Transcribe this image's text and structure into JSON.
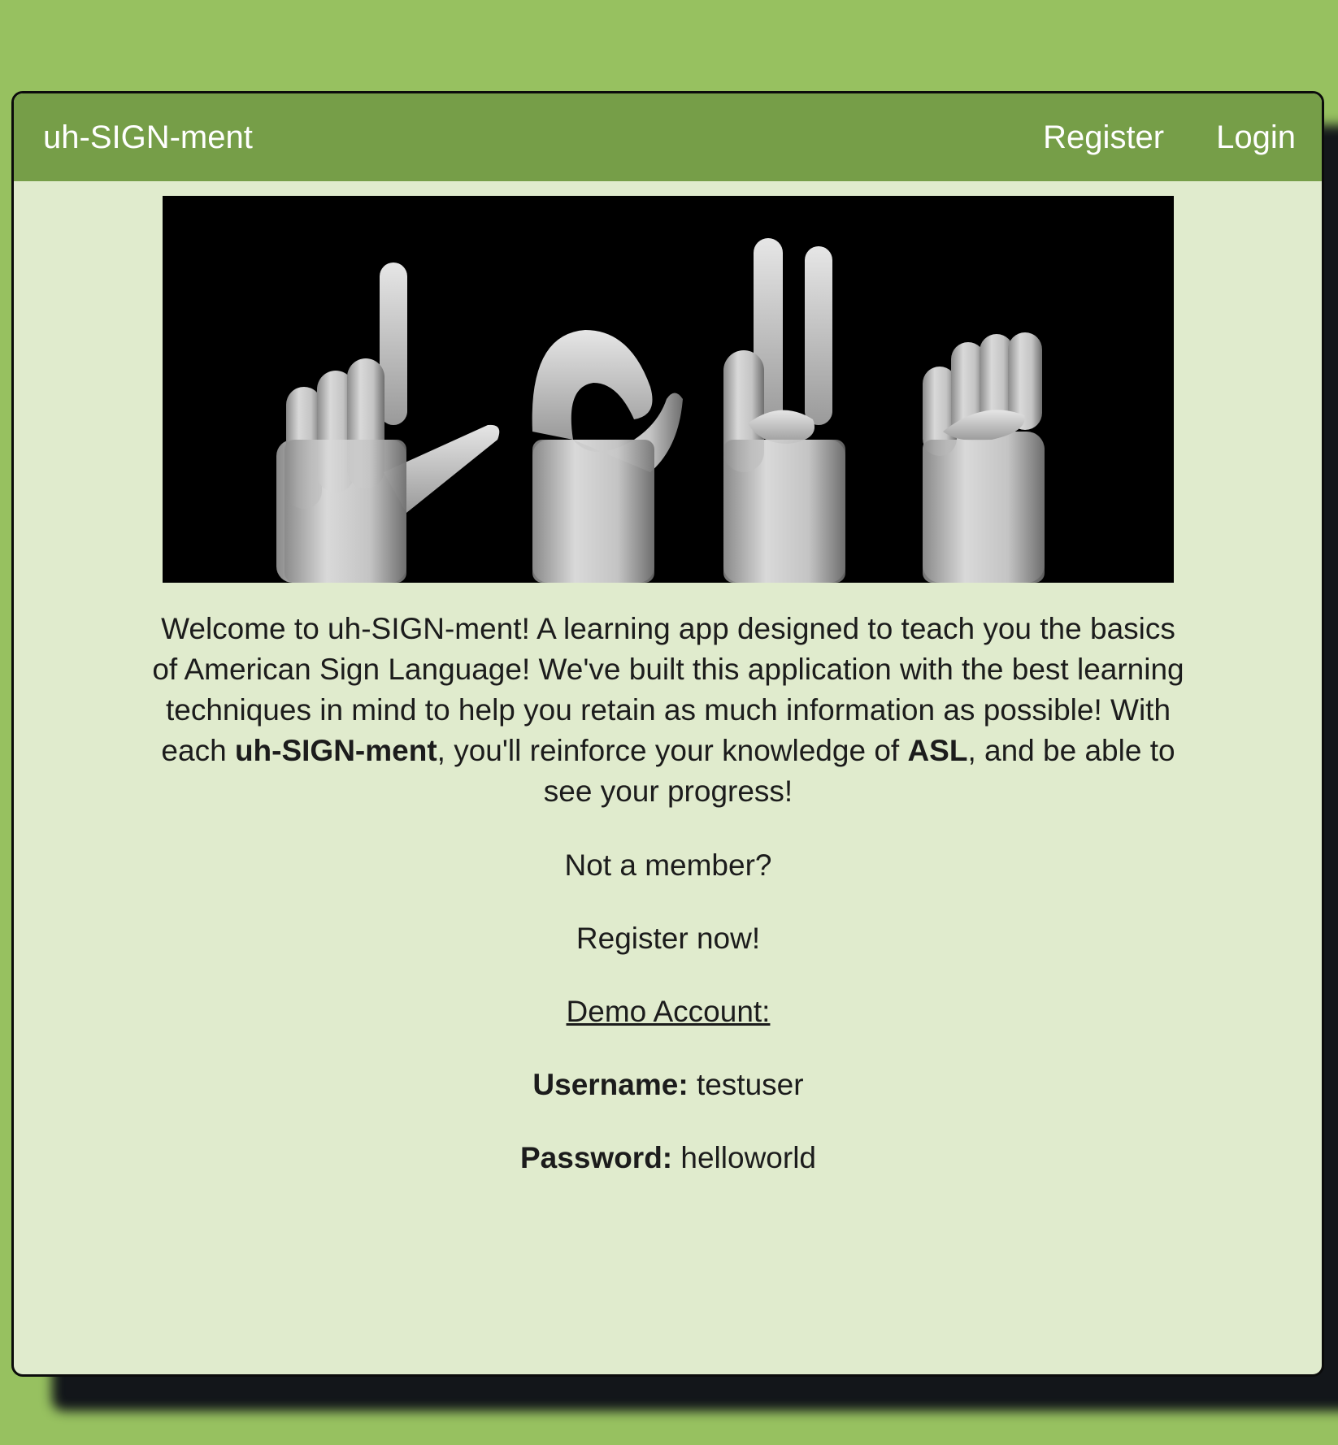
{
  "navbar": {
    "brand": "uh-SIGN-ment",
    "links": [
      {
        "label": "Register"
      },
      {
        "label": "Login"
      }
    ]
  },
  "hero": {
    "alt": "Hands fingerspelling L-O-V-E in American Sign Language"
  },
  "intro": {
    "part1": "Welcome to uh-SIGN-ment! A learning app designed to teach you the basics of American Sign Language! We've built this application with the best learning techniques in mind to help you retain as much information as possible! With each ",
    "bold1": "uh-SIGN-ment",
    "part2": ", you'll reinforce your knowledge of ",
    "bold2": "ASL",
    "part3": ", and be able to see your progress!"
  },
  "cta": {
    "not_member": "Not a member?",
    "register_now": "Register now!"
  },
  "demo": {
    "title": "Demo Account:",
    "username_label": "Username:",
    "username_value": "testuser",
    "password_label": "Password:",
    "password_value": "helloworld"
  },
  "colors": {
    "page_background": "#97c160",
    "navbar": "#769e48",
    "panel": "#e0ebcd",
    "text": "#1c1c1c"
  }
}
